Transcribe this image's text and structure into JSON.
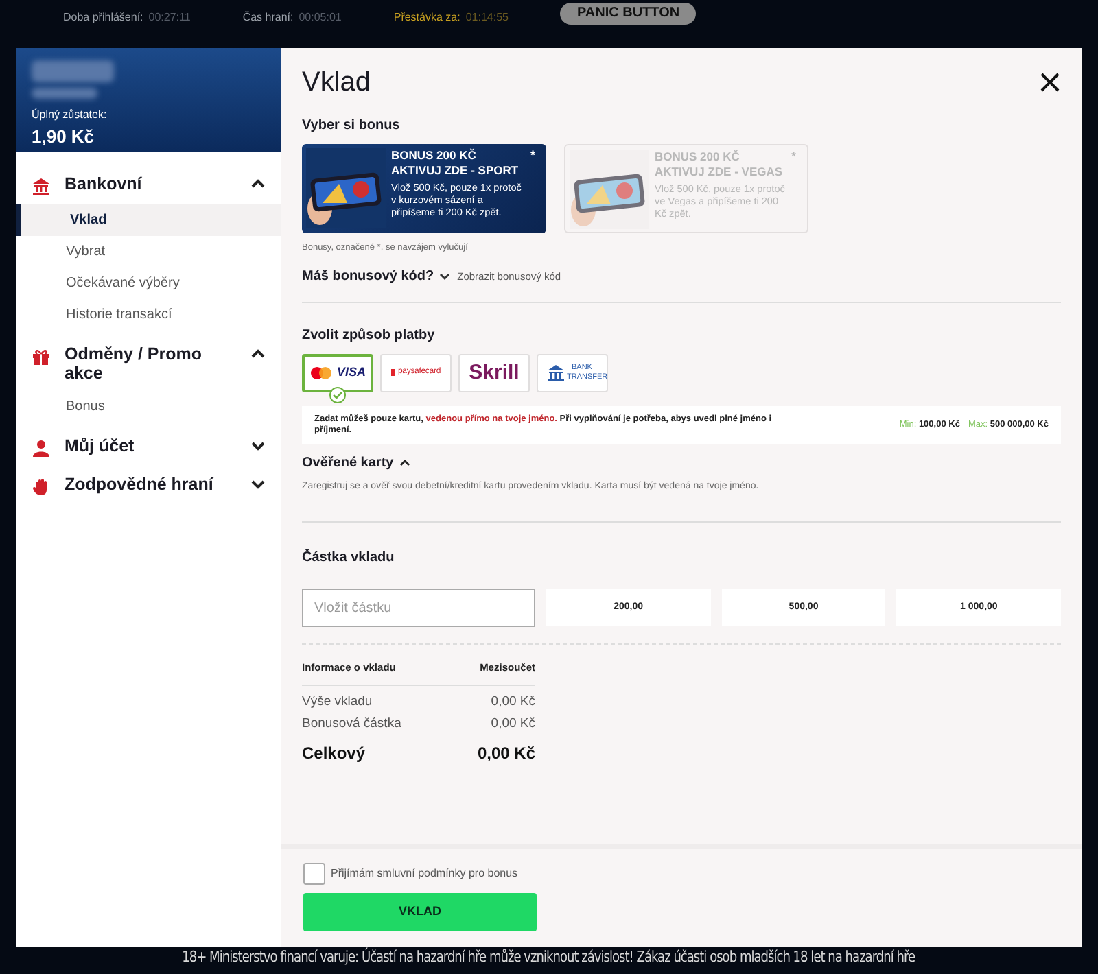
{
  "top_bar": {
    "stats": [
      {
        "label": "Doba přihlášení:",
        "value": "00:27:11",
        "kind": "normal"
      },
      {
        "label": "Čas hraní:",
        "value": "00:05:01",
        "kind": "normal"
      },
      {
        "label": "Přestávka za:",
        "value": "01:14:55",
        "kind": "warning"
      }
    ],
    "panic_button": "PANIC BUTTON"
  },
  "account": {
    "balance_label": "Úplný zůstatek:",
    "balance": "1,90 Kč"
  },
  "sidebar": {
    "sections": [
      {
        "label": "Bankovní",
        "kind": "bank",
        "expanded": true,
        "children": [
          {
            "label": "Vklad",
            "selected": true
          },
          {
            "label": "Vybrat",
            "selected": false
          },
          {
            "label": "Očekávané výběry",
            "selected": false
          },
          {
            "label": "Historie transakcí",
            "selected": false
          }
        ]
      },
      {
        "label": "Odměny / Promo akce",
        "kind": "gift",
        "expanded": true,
        "children": [
          {
            "label": "Bonus",
            "selected": false
          }
        ]
      },
      {
        "label": "Můj účet",
        "kind": "user",
        "expanded": false
      },
      {
        "label": "Zodpovědné hraní",
        "kind": "hand",
        "expanded": false
      }
    ]
  },
  "main": {
    "title": "Vklad",
    "bonus_heading": "Vyber si bonus",
    "bonuses": [
      {
        "title": "BONUS 200 KČ AKTIVUJ ZDE - SPORT",
        "text": "Vlož 500 Kč, pouze 1x protoč v kurzovém sázení a připíšeme ti 200 Kč zpět.",
        "mark": "*",
        "selected": true
      },
      {
        "title": "BONUS 200 KČ AKTIVUJ ZDE - VEGAS",
        "text": "Vlož 500 Kč, pouze 1x protoč ve Vegas a připíšeme ti 200 Kč zpět.",
        "mark": "*",
        "selected": false
      }
    ],
    "bonus_note": "Bonusy, označené *, se navzájem vylučují",
    "bonus_code_label": "Máš bonusový kód?",
    "bonus_code_link": "Zobrazit bonusový kód",
    "payment_heading": "Zvolit způsob platby",
    "payment_methods": [
      {
        "kind": "card",
        "label": "VISA",
        "selected": true
      },
      {
        "kind": "paysafe",
        "label": "paysafecard",
        "selected": false
      },
      {
        "kind": "skrill",
        "label": "Skrill",
        "selected": false
      },
      {
        "kind": "bank",
        "label": "BANK TRANSFER",
        "selected": false
      }
    ],
    "notice": "Zadat můžeš pouze kartu, **vedenou přímo na tvoje jméno.** Při vyplňování je potřeba, abys uvedl plné jméno i příjmení.",
    "min_label": "Min:",
    "min_value": "100,00 Kč",
    "max_label": "Max:",
    "max_value": "500 000,00 Kč",
    "verified_cards": {
      "label": "Ověřené karty",
      "expanded": true,
      "text": "Zaregistruj se a ověř svou debetní/kreditní kartu provedením vkladu. Karta musí být vedená na tvoje jméno."
    },
    "amount_heading": "Částka vkladu",
    "amount_field": {
      "placeholder": "Vložit částku"
    },
    "presets": [
      "200,00",
      "500,00",
      "1 000,00"
    ],
    "summary": {
      "columns": [
        "Informace o vkladu",
        "Mezisoučet"
      ],
      "rows": [
        {
          "label": "Výše vkladu",
          "value": "0,00 Kč",
          "kind": "normal"
        },
        {
          "label": "Bonusová částka",
          "value": "0,00 Kč",
          "kind": "normal"
        },
        {
          "label": "Celkový",
          "value": "0,00 Kč",
          "kind": "total"
        }
      ]
    },
    "terms": {
      "label": "Přijímám smluvní podmínky pro bonus",
      "checked": false
    },
    "submit": "VKLAD"
  },
  "footer": "18+ Ministerstvo financí varuje: Účastí na hazardní hře může vzniknout závislost! Zákaz účasti osob mladších 18 let na hazardní hře"
}
